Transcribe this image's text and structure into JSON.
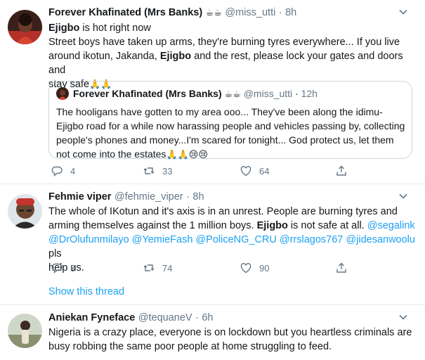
{
  "tweet1": {
    "name": "Forever Khafinated (Mrs Banks)",
    "name_emoji": "☕☕",
    "handle": "@miss_utti",
    "dot": "·",
    "time": "8h",
    "line1_bold": "Ejigbo",
    "line1_rest": " is hot right now",
    "line2": "Street boys have taken up arms, they're burning tyres everywhere... If you live",
    "line3_a": "around ikotun, Jakanda, ",
    "line3_bold": "Ejigbo",
    "line3_b": " and the rest, please lock your gates and doors and",
    "line4": "stay safe",
    "line4_emoji": "🙏🙏",
    "quote": {
      "name": "Forever Khafinated (Mrs Banks)",
      "name_emoji": "☕☕",
      "handle": "@miss_utti",
      "dot": "·",
      "time": "12h",
      "line1": "The hooligans have gotten to my area ooo... They've been along the idimu-",
      "line2": "Ejigbo road for a while now harassing people and vehicles passing by, collecting",
      "line3": "people's phones and money...I'm scared for tonight... God protect us, let them",
      "line4": "not come into the estates",
      "line4_emoji": "🙏🙏😢😢"
    },
    "replies": "4",
    "retweets": "33",
    "likes": "64"
  },
  "tweet2": {
    "name": "Fehmie viper",
    "handle": "@fehmie_viper",
    "dot": "·",
    "time": "8h",
    "line1": "The whole of IKotun and it's axis is in an unrest. People are burning tyres and",
    "line2_a": "arming themselves against the 1 million boys. ",
    "line2_bold": "Ejigbo",
    "line2_b": " is not safe at all. ",
    "line2_mention": "@segalink",
    "line3_mentions": "@DrOlufunmilayo @YemieFash @PoliceNG_CRU @rrslagos767 @jidesanwoolu",
    "line3_rest": " pls",
    "line4": "help us.",
    "replies": "3",
    "retweets": "74",
    "likes": "90",
    "show_thread": "Show this thread"
  },
  "tweet3": {
    "name": "Aniekan Fyneface",
    "handle": "@tequaneV",
    "dot": "·",
    "time": "6h",
    "line1": "Nigeria is a crazy place, everyone is on lockdown but you heartless criminals are",
    "line2": "busy robbing the same poor people at home struggling to feed."
  },
  "colors": {
    "text": "#14171a",
    "secondary": "#657786",
    "link": "#1da1f2",
    "divider": "#e6ecf0"
  },
  "icons": [
    "reply-icon",
    "retweet-icon",
    "like-icon",
    "share-icon",
    "chevron-down-icon"
  ]
}
